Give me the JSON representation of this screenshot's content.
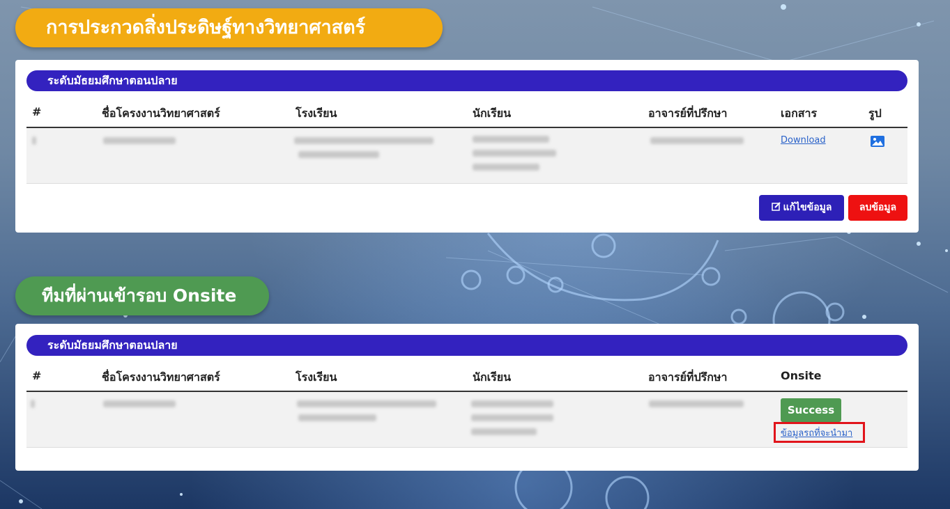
{
  "section1": {
    "title": "การประกวดสิ่งประดิษฐ์ทางวิทยาศาสตร์",
    "level_label": "ระดับมัธยมศึกษาตอนปลาย",
    "columns": [
      "#",
      "ชื่อโครงงานวิทยาศาสตร์",
      "โรงเรียน",
      "นักเรียน",
      "อาจารย์ที่ปรึกษา",
      "เอกสาร",
      "รูป"
    ],
    "row": {
      "document_link": "Download",
      "image_icon": "image-icon"
    },
    "edit_button": "แก้ไขข้อมูล",
    "delete_button": "ลบข้อมูล"
  },
  "section2": {
    "title": "ทีมที่ผ่านเข้ารอบ Onsite",
    "level_label": "ระดับมัธยมศึกษาตอนปลาย",
    "columns": [
      "#",
      "ชื่อโครงงานวิทยาศาสตร์",
      "โรงเรียน",
      "นักเรียน",
      "อาจารย์ที่ปรึกษา",
      "Onsite"
    ],
    "row": {
      "status": "Success",
      "vehicle_link": "ข้อมูลรถที่จะนำมา"
    }
  },
  "colors": {
    "orange_title": "#f2ab12",
    "green_title": "#4f9a52",
    "level_bar": "#3322bf",
    "edit_button": "#2d20b7",
    "delete_button": "#ee1111",
    "highlight_box": "#e1141b"
  },
  "icons": [
    "edit-icon",
    "image-icon"
  ]
}
